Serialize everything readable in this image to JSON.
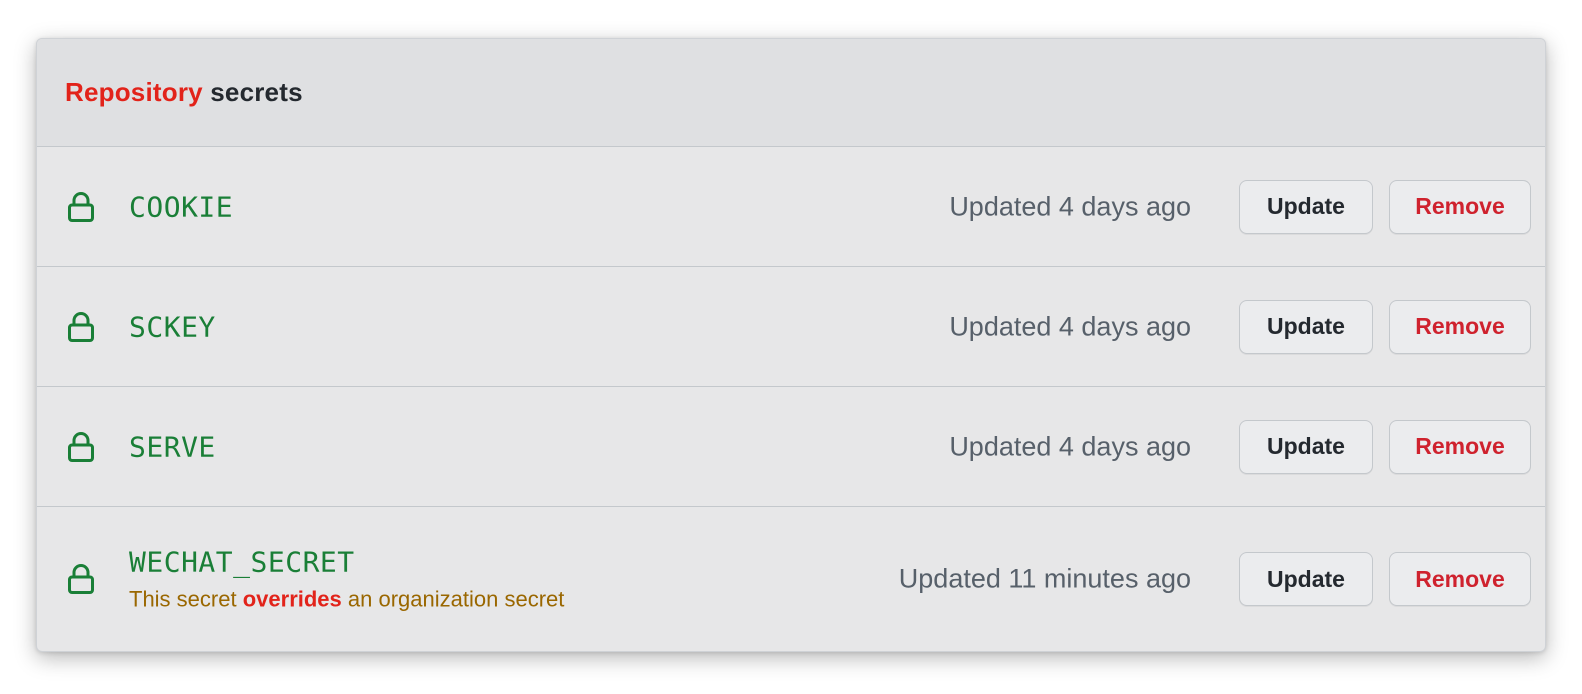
{
  "header": {
    "title_accent": "Repository",
    "title_rest": "secrets"
  },
  "colors": {
    "accent_red": "#e2231a",
    "secret_green": "#1a7f37",
    "note_amber": "#9a6700",
    "remove_red": "#cf222e"
  },
  "secrets": [
    {
      "name": "COOKIE",
      "updated": "Updated 4 days ago",
      "update_label": "Update",
      "remove_label": "Remove",
      "icon": "lock-icon"
    },
    {
      "name": "SCKEY",
      "updated": "Updated 4 days ago",
      "update_label": "Update",
      "remove_label": "Remove",
      "icon": "lock-icon"
    },
    {
      "name": "SERVE",
      "updated": "Updated 4 days ago",
      "update_label": "Update",
      "remove_label": "Remove",
      "icon": "lock-icon"
    },
    {
      "name": "WECHAT_SECRET",
      "updated": "Updated 11 minutes ago",
      "update_label": "Update",
      "remove_label": "Remove",
      "icon": "lock-icon",
      "note": {
        "before": "This secret",
        "accent": "overrides",
        "after": "an organization secret"
      }
    }
  ]
}
